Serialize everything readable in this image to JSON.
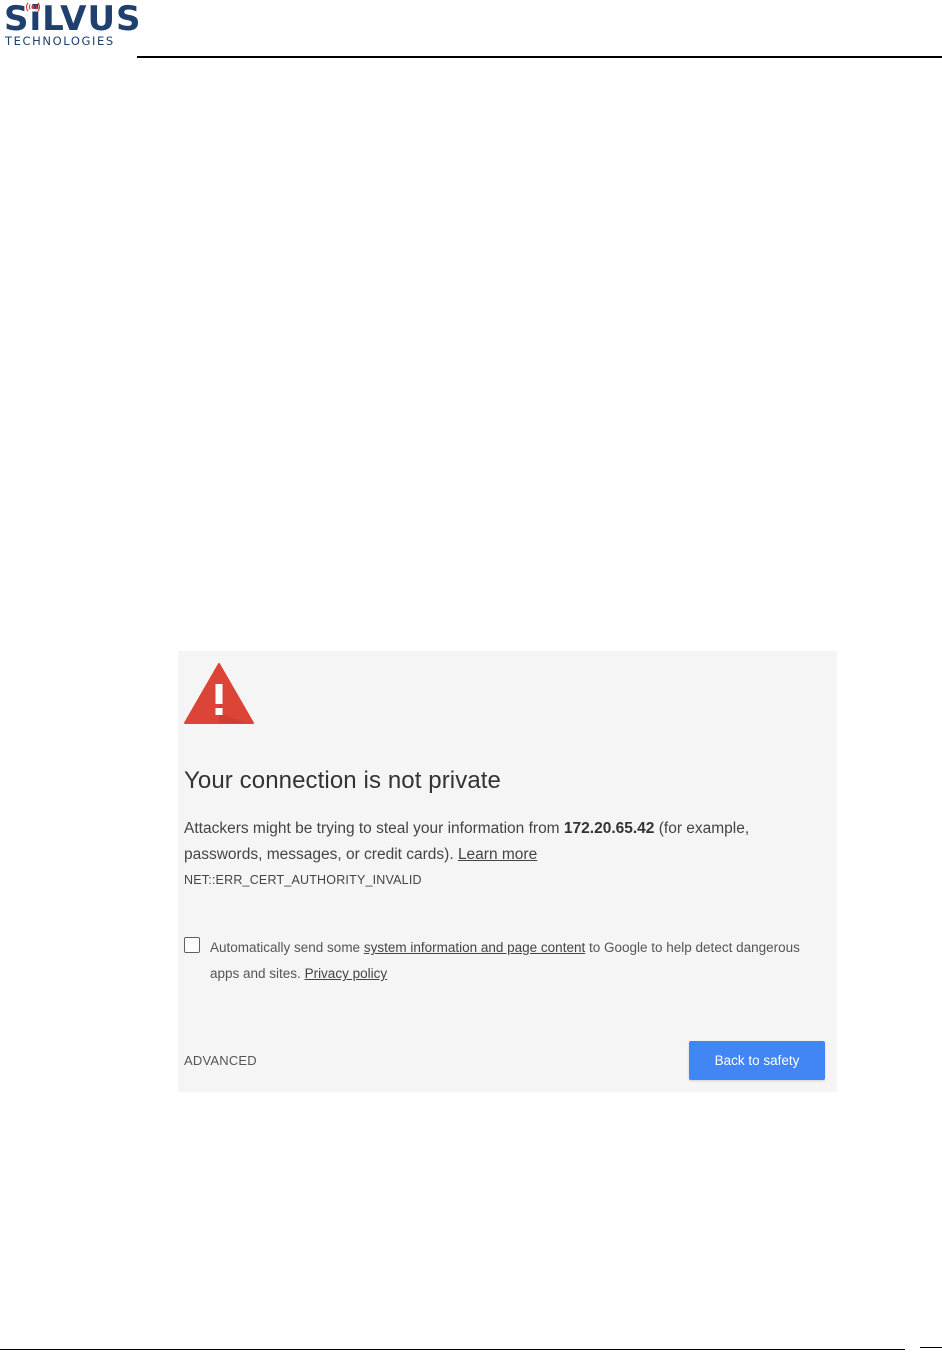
{
  "logo": {
    "word_prefix": "S",
    "word_i": "i",
    "word_suffix": "LVUS",
    "subtitle": "TECHNOLOGIES",
    "brand_color": "#1f3f6e",
    "signal_color": "#d9302b"
  },
  "screenshot": {
    "heading": "Your connection is not private",
    "body": {
      "prefix": "Attackers might be trying to steal your information from ",
      "host": "172.20.65.42",
      "suffix": " (for example, passwords, messages, or credit cards). ",
      "learn_more": "Learn more"
    },
    "error_code": "NET::ERR_CERT_AUTHORITY_INVALID",
    "checkbox": {
      "checked": false,
      "text_before": "Automatically send some ",
      "link1": "system information and page content",
      "text_middle": " to Google to help detect dangerous apps and sites. ",
      "link2": "Privacy policy"
    },
    "advanced_label": "ADVANCED",
    "back_button_label": "Back to safety",
    "icon": "warning-triangle-icon",
    "colors": {
      "panel_bg": "#f5f5f5",
      "warning": "#db4437",
      "button": "#4285f4"
    }
  }
}
